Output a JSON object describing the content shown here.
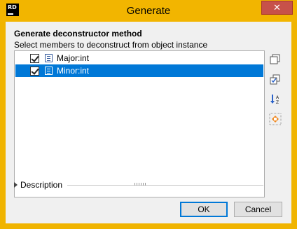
{
  "window": {
    "title": "Generate",
    "app_icon_text": "RD",
    "close_glyph": "✕"
  },
  "dialog": {
    "heading": "Generate deconstructor method",
    "subheading": "Select members to deconstruct from object instance"
  },
  "members": [
    {
      "label": "Major:int",
      "checked": true,
      "selected": false,
      "icon": "field-icon"
    },
    {
      "label": "Minor:int",
      "checked": true,
      "selected": true,
      "icon": "field-icon"
    }
  ],
  "side_toolbar": [
    {
      "name": "select-all-icon"
    },
    {
      "name": "select-none-icon"
    },
    {
      "name": "sort-alphabetically-icon"
    },
    {
      "name": "hierarchy-icon"
    }
  ],
  "description": {
    "label": "Description"
  },
  "buttons": {
    "ok_label": "OK",
    "cancel_label": "Cancel"
  },
  "colors": {
    "frame": "#f2b500",
    "selection": "#0078d7",
    "close": "#c7514a"
  }
}
